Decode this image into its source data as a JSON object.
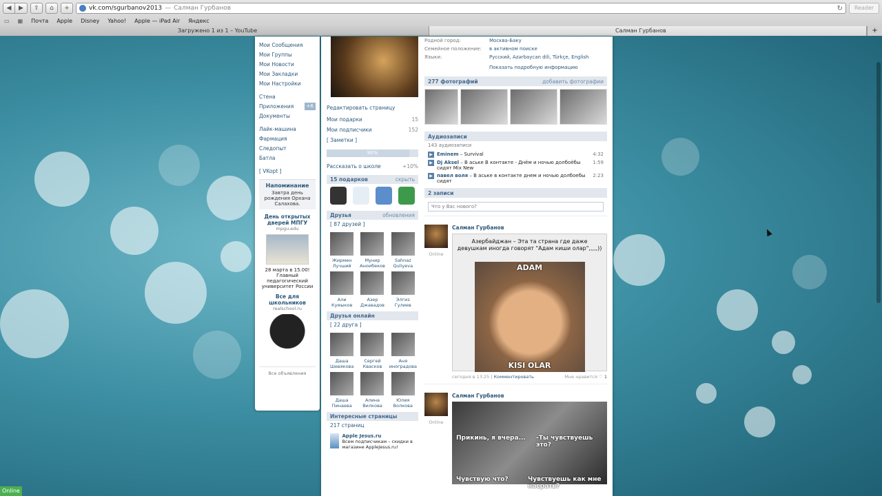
{
  "browser": {
    "url_host": "vk.com/sgurbanov2013",
    "url_sep": "—",
    "page_title": "Салман Гурбанов",
    "reader_label": "Reader",
    "bookmarks": [
      "Почта",
      "Apple",
      "Disney",
      "Yahoo!",
      "Apple — iPad Air",
      "Яндекс"
    ],
    "tabs": [
      "Загружено 1 из 1 – YouTube",
      "Салман Гурбанов"
    ],
    "new_tab": "+"
  },
  "leftmenu": {
    "items": [
      "Мои Сообщения",
      "Мои Группы",
      "Мои Новости",
      "Мои Закладки",
      "Мои Настройки"
    ],
    "items2": [
      "Стена",
      "Приложения",
      "Документы"
    ],
    "apps_badge": "+6",
    "items3": [
      "Лайк-машина",
      "Фармация",
      "Следопыт",
      "Батла"
    ],
    "vkopt": "[ VKopt ]",
    "reminder": {
      "title": "Напоминание",
      "body": "Завтра день рождения Орхана Салахова."
    },
    "ad1": {
      "title": "День открытых дверей МПГУ",
      "sub": "mpgu.edu",
      "body": "28 марта в 15.00! Главный педагогический университет России"
    },
    "ad2": {
      "title": "Все для школьников",
      "sub": "realschool.ru"
    },
    "all_ads": "Все объявления"
  },
  "profile": {
    "edit": "Редактировать страницу",
    "gifts_link": "Мои подарки",
    "gifts_count": "15",
    "subs_link": "Мои подписчики",
    "subs_count": "152",
    "notes": "[ Заметки ]",
    "progress": "90%",
    "school": "Рассказать о школе",
    "school_pct": "+10%",
    "gifts_head": "15 подарков",
    "gifts_hide": "скрыть",
    "friends_head": "Друзья",
    "friends_updates": "обновления",
    "friends_count": "[ 87 друзей ]",
    "friends": [
      [
        "Жирмен",
        "Лучший"
      ],
      [
        "Мунир",
        "Аноибеков"
      ],
      [
        "Sahnaz",
        "Quliyeva"
      ],
      [
        "Али",
        "Кумыков"
      ],
      [
        "Азер",
        "Джавадов"
      ],
      [
        "Элгиз",
        "Гулиев"
      ]
    ],
    "online_head": "Друзья онлайн",
    "online_count": "[ 22 друга ]",
    "online_friends": [
      [
        "Даша",
        "Шевякова"
      ],
      [
        "Сергей",
        "Квасков"
      ],
      [
        "Аня",
        "иноградова"
      ],
      [
        "Даша",
        "Пинаева"
      ],
      [
        "Алина",
        "Вилкова"
      ],
      [
        "Юлия",
        "Волкова"
      ]
    ],
    "pages_head": "Интересные страницы",
    "pages_count": "217 страниц",
    "page_name": "Apple Jesus.ru",
    "page_desc": "Всем подписчикам – скидки в магазине AppleJesus.ru!"
  },
  "info": {
    "rows": [
      [
        "Родной город:",
        "Москва-Баку"
      ],
      [
        "Семейное положение:",
        "в активном поиске"
      ],
      [
        "Языки:",
        "Русский, Azərbaycan dili, Türkçe, English"
      ]
    ],
    "more": "Показать подробную информацию",
    "photos_head": "277 фотографий",
    "photos_add": "добавить фотографии",
    "audio_head": "Аудиозаписи",
    "audio_count": "143 аудиозаписи",
    "tracks": [
      {
        "artist": "Eminem",
        "title": "– Survival",
        "dur": "4:32"
      },
      {
        "artist": "Dj Aksel",
        "title": "– В аське В контакте - Днём и ночью долбоёбы сидят Mix New",
        "dur": "1:59"
      },
      {
        "artist": "павел воля",
        "title": "– В аське в контакте днем и ночью долбоебы сидят",
        "dur": "2:23"
      }
    ],
    "wall_head": "2 записи",
    "post_placeholder": "Что у Вас нового?",
    "post1": {
      "author": "Салман Гурбанов",
      "status": "Online",
      "caption": "Азербайджан – Эта та страна где даже девушкам иногда говорят \"Адам киши олар\",,,,,))",
      "top": "ADAM",
      "bottom": "KISI OLAR",
      "time": "сегодня в 13:25",
      "comment": "Комментировать",
      "like": "Мне нравится",
      "likes": "1"
    },
    "post2": {
      "author": "Салман Гурбанов",
      "status": "Online",
      "m1": "Прикинь, я вчера...",
      "m2": "-Ты чувствуешь это?",
      "m3": "Чувствую что?",
      "m4": "Чувствуешь как мне насрать?"
    }
  },
  "status_online": "Online"
}
